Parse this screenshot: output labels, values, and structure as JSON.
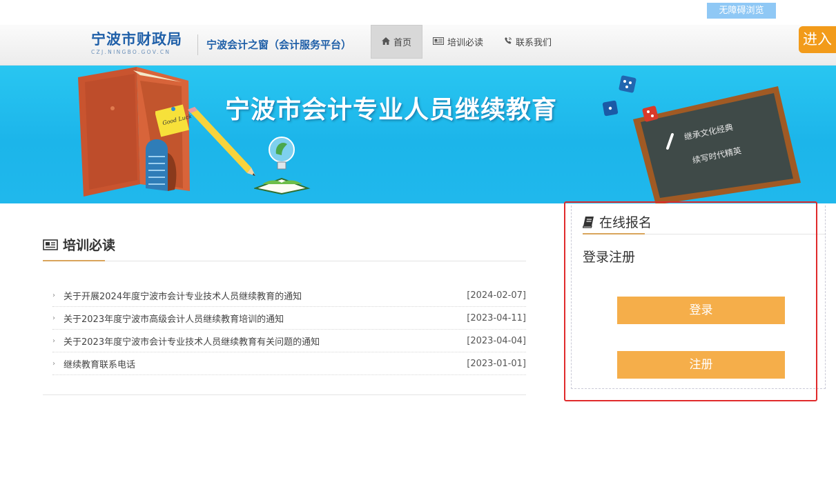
{
  "topbar": {
    "accessibility_label": "无障碍浏览",
    "enter_label": "进入"
  },
  "header": {
    "logo_cn": "宁波市财政局",
    "logo_en": "CZJ.NINGBO.GOV.CN",
    "subtitle": "宁波会计之窗（会计服务平台）",
    "nav": [
      {
        "label": "首页",
        "icon": "home-icon",
        "active": true
      },
      {
        "label": "培训必读",
        "icon": "newspaper-icon",
        "active": false
      },
      {
        "label": "联系我们",
        "icon": "phone-icon",
        "active": false
      }
    ]
  },
  "banner": {
    "title": "宁波市会计专业人员继续教育",
    "note_text": "Good Luck!",
    "board_line1": "继承文化经典",
    "board_line2": "续写时代精英"
  },
  "training": {
    "title": "培训必读",
    "items": [
      {
        "title": "关于开展2024年度宁波市会计专业技术人员继续教育的通知",
        "date": "[2024-02-07]"
      },
      {
        "title": "关于2023年度宁波市高级会计人员继续教育培训的通知",
        "date": "[2023-04-11]"
      },
      {
        "title": "关于2023年度宁波市会计专业技术人员继续教育有关问题的通知",
        "date": "[2023-04-04]"
      },
      {
        "title": "继续教育联系电话",
        "date": "[2023-01-01]"
      }
    ]
  },
  "signup": {
    "title": "在线报名",
    "subtitle": "登录注册",
    "login_label": "登录",
    "register_label": "注册"
  },
  "colors": {
    "accent_orange": "#f5ae4a",
    "brand_blue": "#1f5fa8",
    "highlight_red": "#e0292a"
  }
}
